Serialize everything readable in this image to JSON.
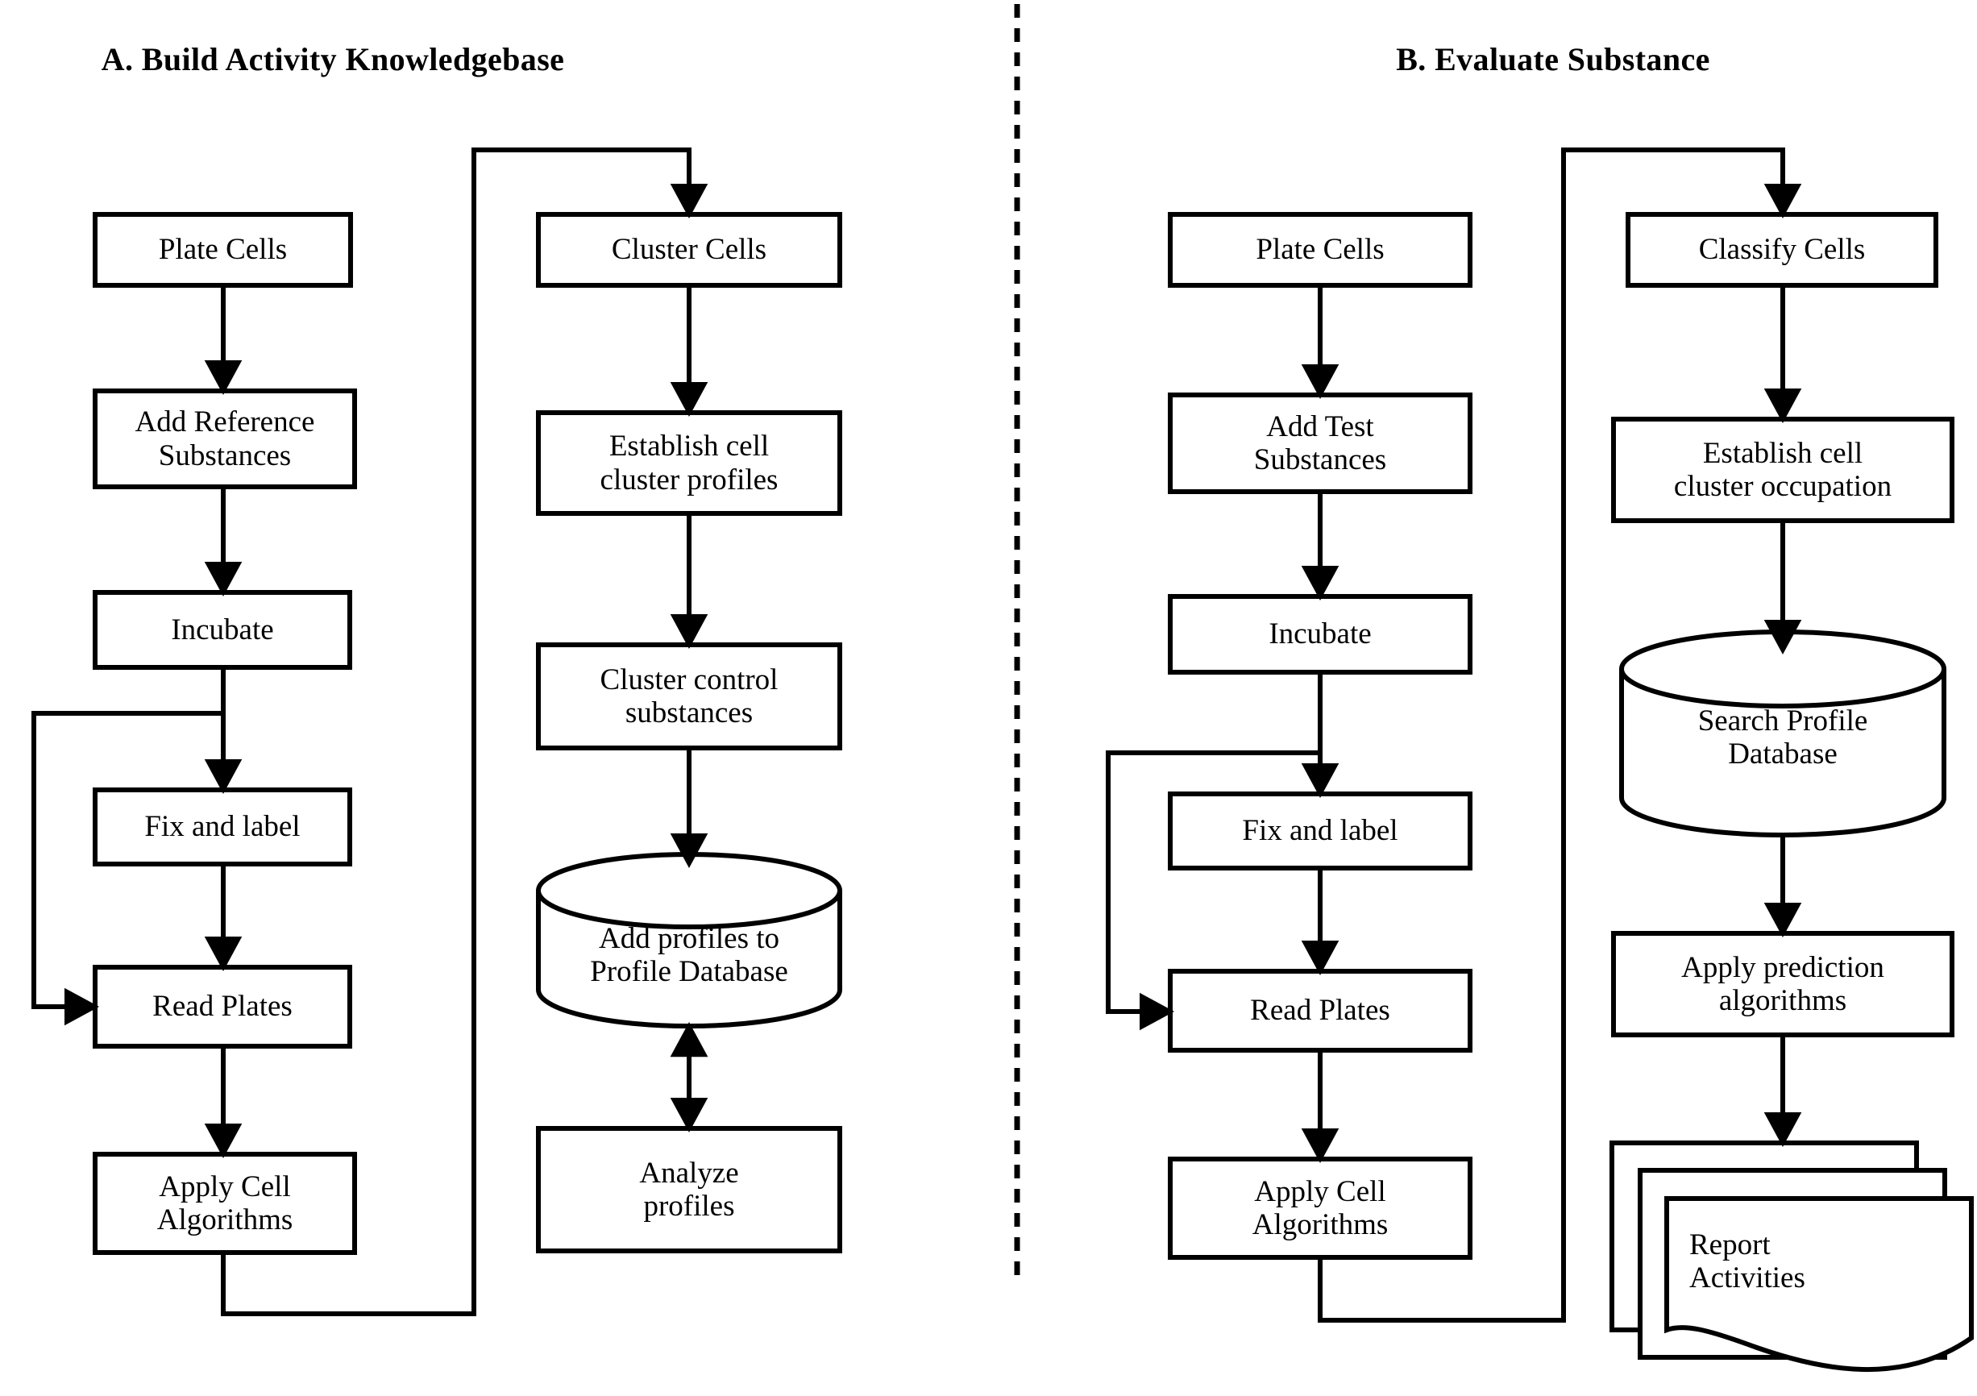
{
  "figure": {
    "type": "flowchart",
    "background_color": "#ffffff",
    "stroke_color": "#000000",
    "divider": {
      "name": "panel-divider",
      "style": "dashed-vertical"
    }
  },
  "panels": [
    {
      "id": "A",
      "title": "A. Build Activity Knowledgebase",
      "left_column": [
        {
          "id": "a-plate-cells",
          "label": "Plate Cells",
          "shape": "rect"
        },
        {
          "id": "a-add-reference-substances",
          "label": "Add Reference\nSubstances",
          "shape": "rect"
        },
        {
          "id": "a-incubate",
          "label": "Incubate",
          "shape": "rect"
        },
        {
          "id": "a-fix-and-label",
          "label": "Fix and label",
          "shape": "rect"
        },
        {
          "id": "a-read-plates",
          "label": "Read Plates",
          "shape": "rect"
        },
        {
          "id": "a-apply-cell-algorithms",
          "label": "Apply Cell\nAlgorithms",
          "shape": "rect"
        }
      ],
      "right_column": [
        {
          "id": "a-cluster-cells",
          "label": "Cluster Cells",
          "shape": "rect"
        },
        {
          "id": "a-establish-cell-cluster-profiles",
          "label": "Establish cell\ncluster profiles",
          "shape": "rect"
        },
        {
          "id": "a-cluster-control-substances",
          "label": "Cluster control\nsubstances",
          "shape": "rect"
        },
        {
          "id": "a-add-profiles-to-profile-database",
          "label": "Add profiles to\nProfile Database",
          "shape": "cylinder"
        },
        {
          "id": "a-analyze-profiles",
          "label": "Analyze\nprofiles",
          "shape": "rect"
        }
      ],
      "connections": [
        {
          "from": "a-plate-cells",
          "to": "a-add-reference-substances",
          "type": "arrow-down"
        },
        {
          "from": "a-add-reference-substances",
          "to": "a-incubate",
          "type": "arrow-down"
        },
        {
          "from": "a-incubate",
          "to": "a-fix-and-label",
          "type": "arrow-down"
        },
        {
          "from": "a-incubate",
          "to": "a-read-plates",
          "type": "feedback-loop-left"
        },
        {
          "from": "a-fix-and-label",
          "to": "a-read-plates",
          "type": "arrow-down"
        },
        {
          "from": "a-read-plates",
          "to": "a-apply-cell-algorithms",
          "type": "arrow-down"
        },
        {
          "from": "a-apply-cell-algorithms",
          "to": "a-cluster-cells",
          "type": "wrap-around-right-up"
        },
        {
          "from": "a-cluster-cells",
          "to": "a-establish-cell-cluster-profiles",
          "type": "arrow-down"
        },
        {
          "from": "a-establish-cell-cluster-profiles",
          "to": "a-cluster-control-substances",
          "type": "arrow-down"
        },
        {
          "from": "a-cluster-control-substances",
          "to": "a-add-profiles-to-profile-database",
          "type": "arrow-down"
        },
        {
          "from": "a-add-profiles-to-profile-database",
          "to": "a-analyze-profiles",
          "type": "arrow-bidirectional"
        }
      ]
    },
    {
      "id": "B",
      "title": "B. Evaluate Substance",
      "left_column": [
        {
          "id": "b-plate-cells",
          "label": "Plate Cells",
          "shape": "rect"
        },
        {
          "id": "b-add-test-substances",
          "label": "Add Test\nSubstances",
          "shape": "rect"
        },
        {
          "id": "b-incubate",
          "label": "Incubate",
          "shape": "rect"
        },
        {
          "id": "b-fix-and-label",
          "label": "Fix and label",
          "shape": "rect"
        },
        {
          "id": "b-read-plates",
          "label": "Read Plates",
          "shape": "rect"
        },
        {
          "id": "b-apply-cell-algorithms",
          "label": "Apply Cell\nAlgorithms",
          "shape": "rect"
        }
      ],
      "right_column": [
        {
          "id": "b-classify-cells",
          "label": "Classify Cells",
          "shape": "rect"
        },
        {
          "id": "b-establish-cell-cluster-occupation",
          "label": "Establish cell\ncluster occupation",
          "shape": "rect"
        },
        {
          "id": "b-search-profile-database",
          "label": "Search Profile\nDatabase",
          "shape": "cylinder"
        },
        {
          "id": "b-apply-prediction-algorithms",
          "label": "Apply prediction\nalgorithms",
          "shape": "rect"
        },
        {
          "id": "b-report-activities",
          "label": "Report\nActivities",
          "shape": "document-stack"
        }
      ],
      "connections": [
        {
          "from": "b-plate-cells",
          "to": "b-add-test-substances",
          "type": "arrow-down"
        },
        {
          "from": "b-add-test-substances",
          "to": "b-incubate",
          "type": "arrow-down"
        },
        {
          "from": "b-incubate",
          "to": "b-fix-and-label",
          "type": "arrow-down"
        },
        {
          "from": "b-incubate",
          "to": "b-read-plates",
          "type": "feedback-loop-left"
        },
        {
          "from": "b-fix-and-label",
          "to": "b-read-plates",
          "type": "arrow-down"
        },
        {
          "from": "b-read-plates",
          "to": "b-apply-cell-algorithms",
          "type": "arrow-down"
        },
        {
          "from": "b-apply-cell-algorithms",
          "to": "b-classify-cells",
          "type": "wrap-around-right-up"
        },
        {
          "from": "b-classify-cells",
          "to": "b-establish-cell-cluster-occupation",
          "type": "arrow-down"
        },
        {
          "from": "b-establish-cell-cluster-occupation",
          "to": "b-search-profile-database",
          "type": "arrow-down"
        },
        {
          "from": "b-search-profile-database",
          "to": "b-apply-prediction-algorithms",
          "type": "arrow-down"
        },
        {
          "from": "b-apply-prediction-algorithms",
          "to": "b-report-activities",
          "type": "arrow-down"
        }
      ]
    }
  ]
}
